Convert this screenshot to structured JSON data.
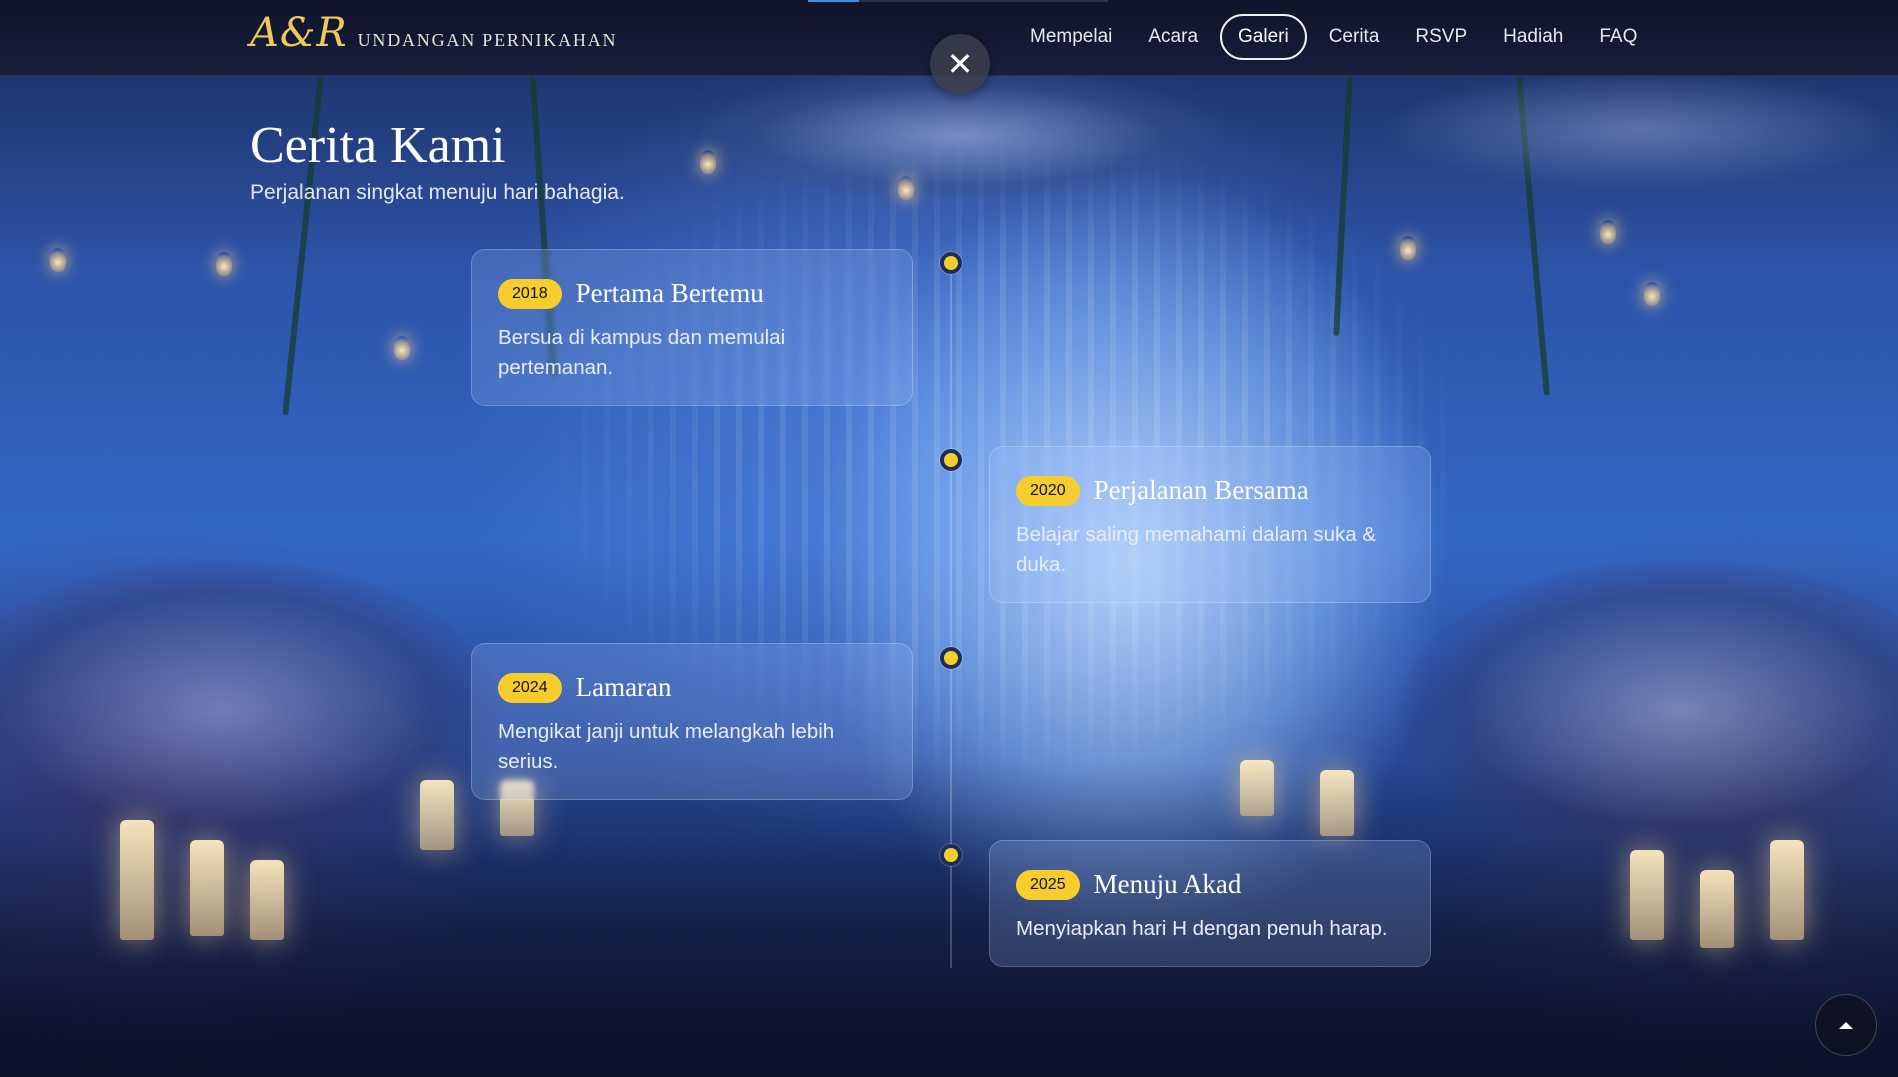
{
  "header": {
    "logo": "A&R",
    "subtitle": "UNDANGAN PERNIKAHAN",
    "nav": [
      {
        "label": "Mempelai"
      },
      {
        "label": "Acara"
      },
      {
        "label": "Galeri",
        "active": true
      },
      {
        "label": "Cerita"
      },
      {
        "label": "RSVP"
      },
      {
        "label": "Hadiah"
      },
      {
        "label": "FAQ"
      }
    ],
    "scroll_progress": 0.17
  },
  "overlay": {
    "close_symbol": "✕"
  },
  "story": {
    "title": "Cerita Kami",
    "subtitle": "Perjalanan singkat menuju hari bahagia.",
    "events": [
      {
        "year": "2018",
        "title": "Pertama Bertemu",
        "text": "Bersua di kampus dan memulai pertemanan.",
        "side": "left"
      },
      {
        "year": "2020",
        "title": "Perjalanan Bersama",
        "text": "Belajar saling memahami dalam suka & duka.",
        "side": "right"
      },
      {
        "year": "2024",
        "title": "Lamaran",
        "text": "Mengikat janji untuk melangkah lebih serius.",
        "side": "left"
      },
      {
        "year": "2025",
        "title": "Menuju Akad",
        "text": "Menyiapkan hari H dengan penuh harap.",
        "side": "right"
      }
    ]
  },
  "colors": {
    "accent_gold": "#f6cd2d",
    "logo_gold": "#f0c75a",
    "progress_blue": "#3a8fe8"
  },
  "icons": {
    "close": "close-icon",
    "scroll_top": "chevron-up-icon",
    "timeline_marker": "timeline-dot-icon"
  }
}
